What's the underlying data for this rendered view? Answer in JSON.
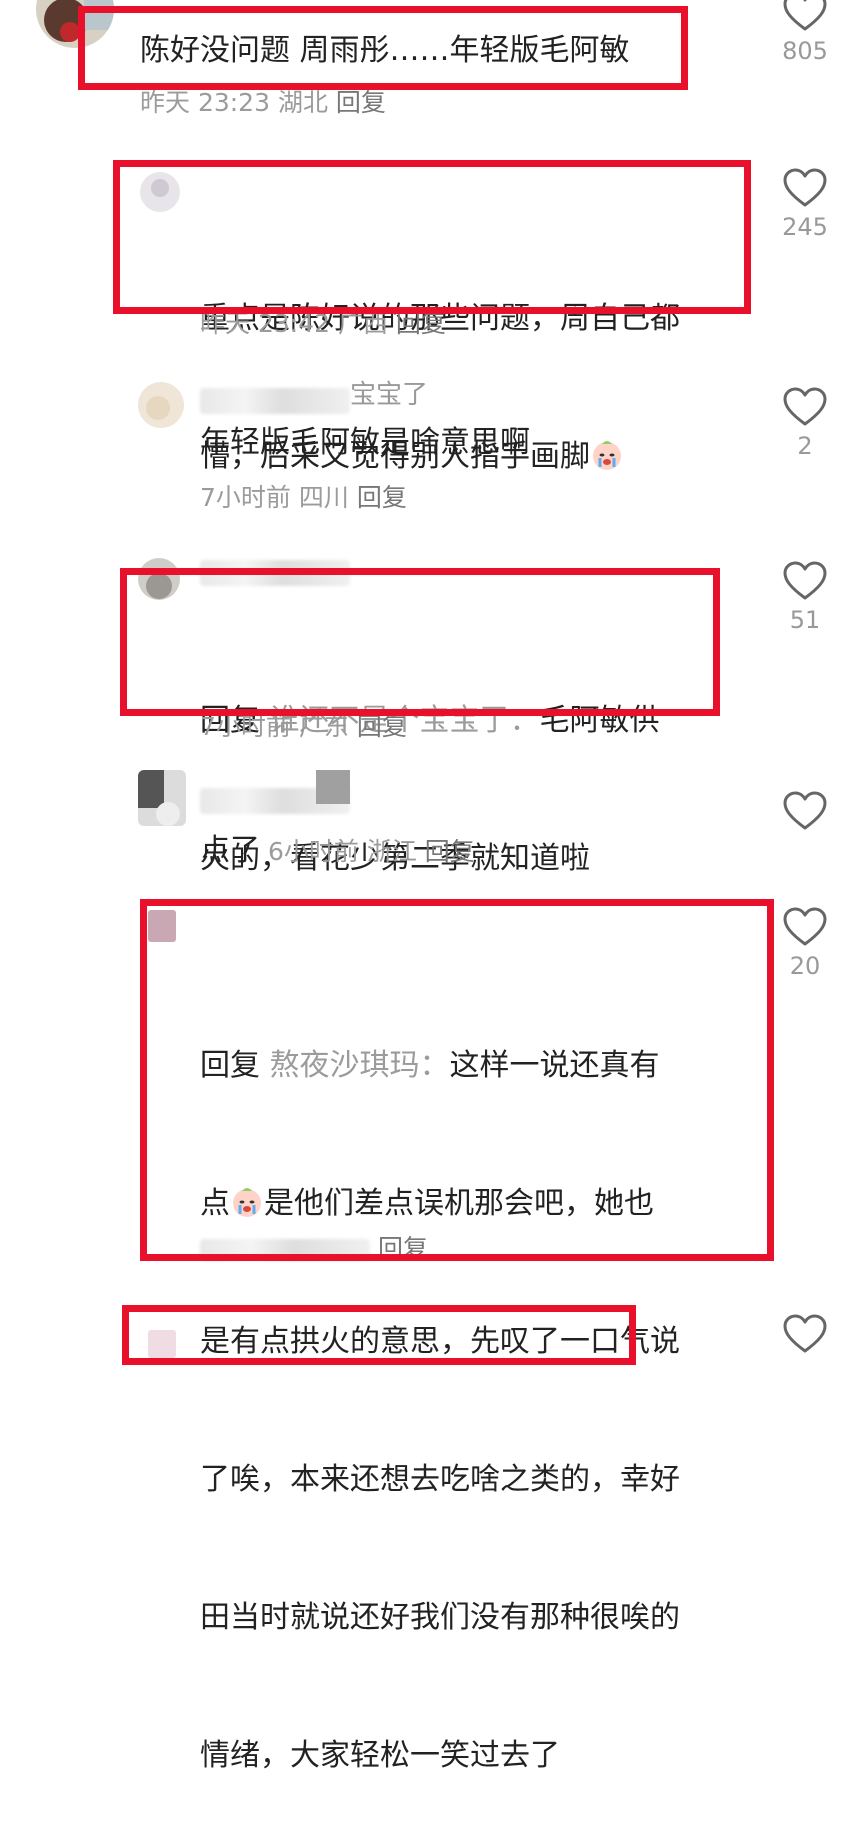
{
  "colors": {
    "highlight": "#e8102a",
    "meta": "#9b9b9b",
    "text": "#222222"
  },
  "comments": [
    {
      "text": "陈好没问题 周雨彤……年轻版毛阿敏",
      "meta": {
        "time": "昨天 23:23",
        "location": "湖北",
        "reply": "回复"
      },
      "likes": "805"
    },
    {
      "line1": "重点是陈好说的那些问题，周自己都",
      "line2": "懵，后采又觉得别人指手画脚",
      "emoji": "crying-face-emoji",
      "meta": {
        "time": "昨天 23:42",
        "location": "广西",
        "reply": "回复"
      },
      "likes": "245"
    },
    {
      "name_partial": "宝宝了",
      "text": "年轻版毛阿敏是啥意思啊",
      "meta": {
        "time": "7小时前",
        "location": "四川",
        "reply": "回复"
      },
      "likes": "2"
    },
    {
      "reply_prefix": "回复",
      "quoted_user": "谁还不是个宝宝了：",
      "line1_rest": "毛阿敏供",
      "line2": "火的，看花少第二季就知道啦",
      "meta": {
        "time": "7小时前",
        "location": "广东",
        "reply": "回复"
      },
      "likes": "51"
    },
    {
      "text": "点了",
      "meta": {
        "time": "6小时前",
        "location": "浙江",
        "reply": "回复"
      },
      "likes": ""
    },
    {
      "reply_prefix": "回复",
      "quoted_user": "熬夜沙琪玛：",
      "line1_rest": "这样一说还真有",
      "line2a": "点",
      "line2b": "是他们差点误机那会吧，她也",
      "line3": "是有点拱火的意思，先叹了一口气说",
      "line4": "了唉，本来还想去吃啥之类的，幸好",
      "line5": "田当时就说还好我们没有那种很唉的",
      "line6": "情绪，大家轻松一笑过去了",
      "meta": {
        "reply": "回复"
      },
      "likes": "20"
    }
  ]
}
